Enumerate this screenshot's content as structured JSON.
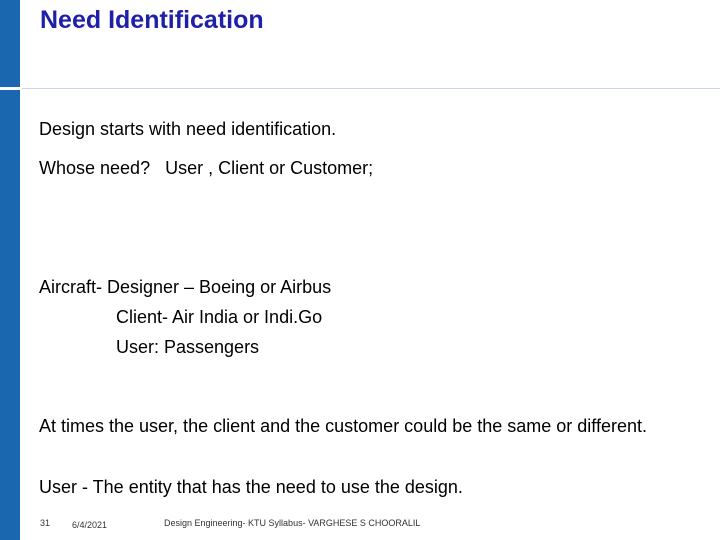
{
  "slide": {
    "title": "Need Identification",
    "lines": [
      "Design starts with need identification.",
      "Whose need?   User , Client or Customer;",
      "Aircraft- Designer – Boeing or Airbus",
      "Client- Air India or Indi.Go",
      "User: Passengers"
    ],
    "paragraph": "At times the user, the client and the customer could be the same or different.",
    "definition": "User - The entity that has the need to use the design."
  },
  "footer": {
    "page_number": "31",
    "date": "6/4/2021",
    "credit": "Design Engineering- KTU Syllabus- VARGHESE S CHOORALIL"
  },
  "colors": {
    "accent_bar": "#1a67b0",
    "title": "#1f1fa8"
  }
}
